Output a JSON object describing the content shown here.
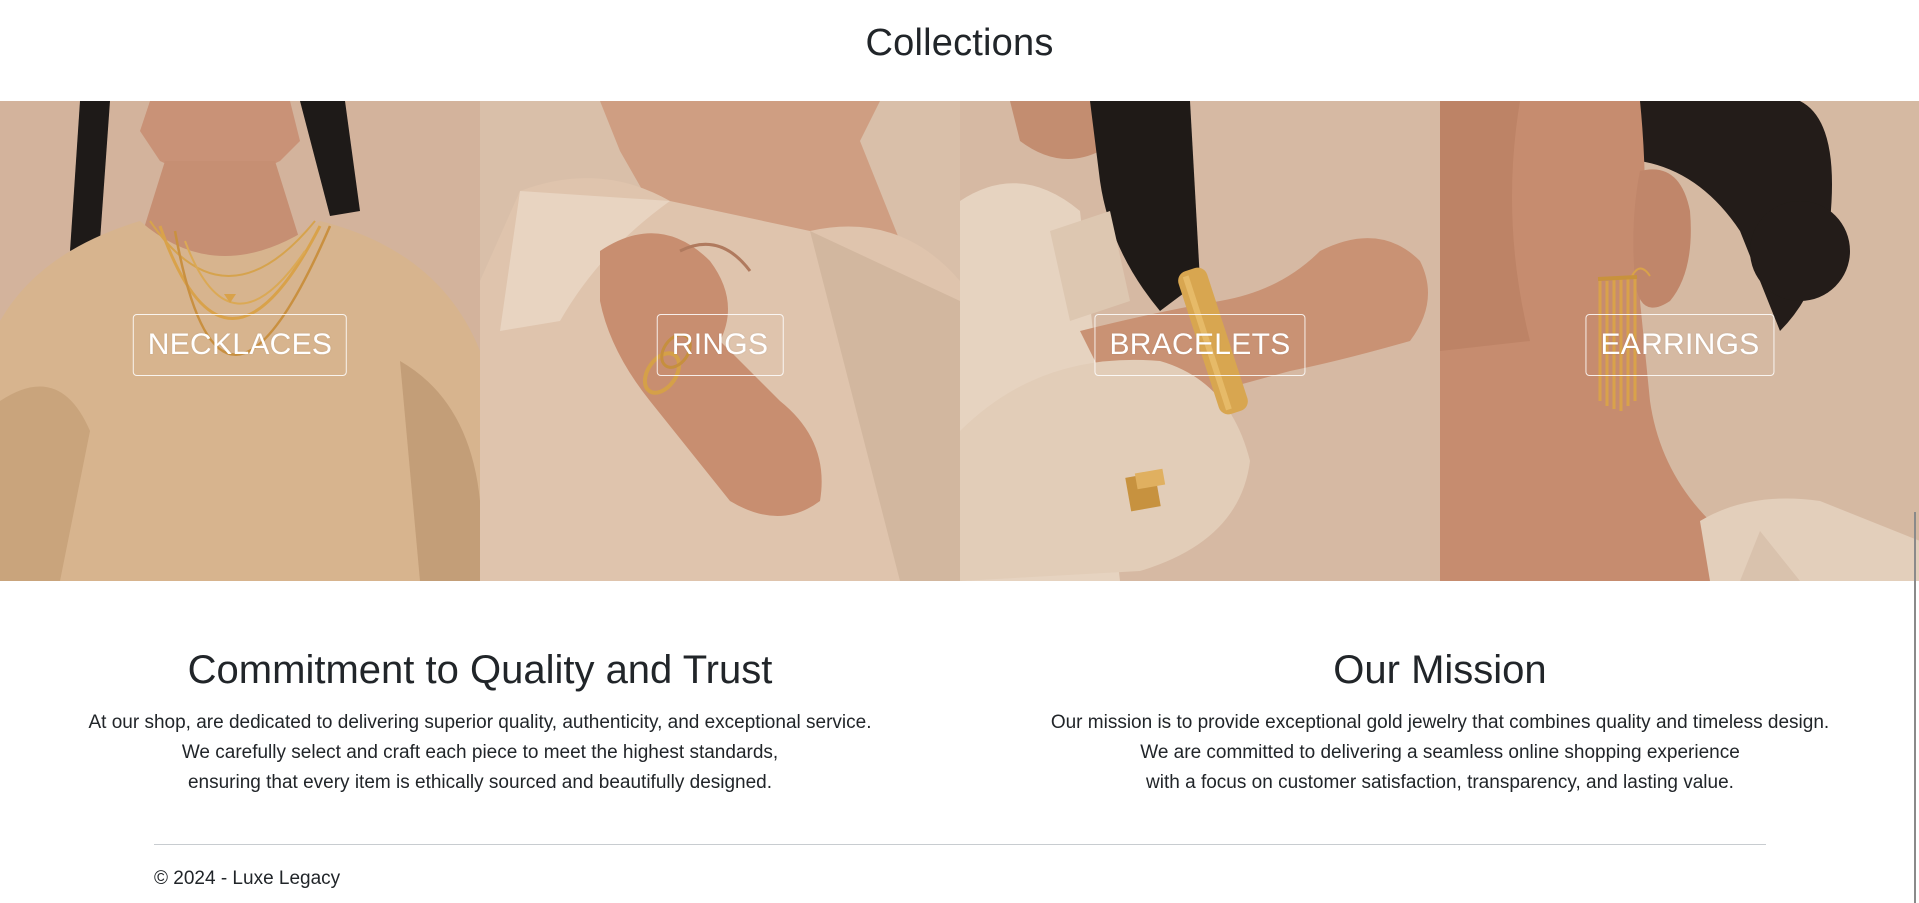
{
  "collections": {
    "title": "Collections",
    "items": [
      {
        "label": "NECKLACES"
      },
      {
        "label": "RINGS"
      },
      {
        "label": "BRACELETS"
      },
      {
        "label": "EARRINGS"
      }
    ]
  },
  "quality": {
    "title": "Commitment to Quality and Trust",
    "line1": "At our shop, are dedicated to delivering superior quality, authenticity, and exceptional service.",
    "line2": "We carefully select and craft each piece to meet the highest standards,",
    "line3": "ensuring that every item is ethically sourced and beautifully designed."
  },
  "mission": {
    "title": "Our Mission",
    "line1": "Our mission is to provide exceptional gold jewelry that combines quality and timeless design.",
    "line2": "We are committed to delivering a seamless online shopping experience",
    "line3": "with a focus on customer satisfaction, transparency, and lasting value."
  },
  "footer": {
    "copyright": "© 2024 - Luxe Legacy"
  },
  "colors": {
    "backdrop": "#d6b8a2",
    "gold": "#d9a24a",
    "skin": "#c89478",
    "fabric": "#e3cdb4"
  }
}
